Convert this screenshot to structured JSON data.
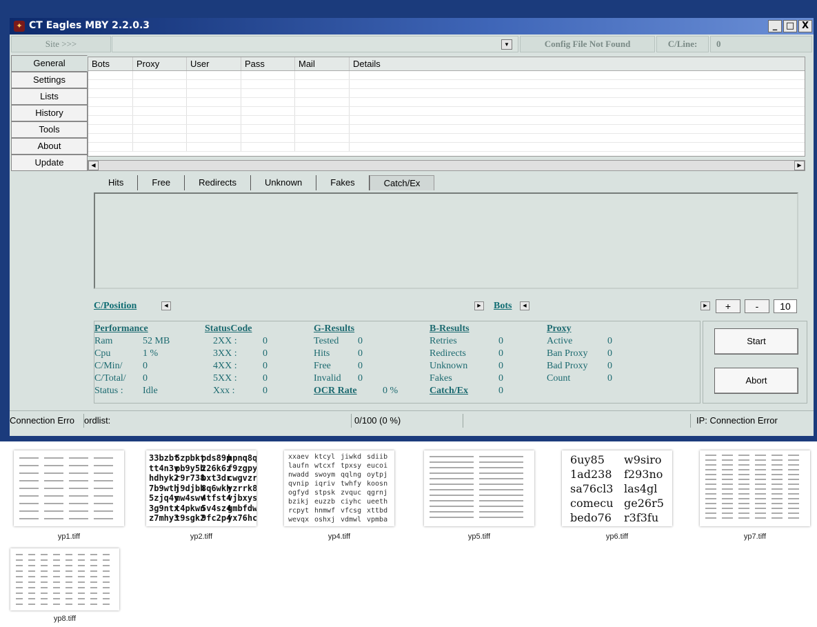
{
  "window": {
    "title": "CT Eagles MBY 2.2.0.3",
    "buttons": [
      "_",
      "□",
      "X"
    ]
  },
  "sitebar": {
    "site_label": "Site >>>",
    "config_status": "Config File Not Found",
    "cline_label": "C/Line:",
    "cline_value": "0"
  },
  "nav": [
    "General",
    "Settings",
    "Lists",
    "History",
    "Tools",
    "About",
    "Update"
  ],
  "grid": {
    "columns": [
      "Bots",
      "Proxy",
      "User",
      "Pass",
      "Mail",
      "Details"
    ]
  },
  "tabs": [
    "Hits",
    "Free",
    "Redirects",
    "Unknown",
    "Fakes",
    "Catch/Ex"
  ],
  "position_row": {
    "cposition": "C/Position",
    "bots": "Bots",
    "plus": "+",
    "minus": "-",
    "count": "10"
  },
  "stats": {
    "performance": {
      "header": "Performance",
      "rows": [
        [
          "Ram",
          "52 MB"
        ],
        [
          "Cpu",
          "1 %"
        ],
        [
          "C/Min/",
          "0"
        ],
        [
          "C/Total/",
          "0"
        ],
        [
          "Status :",
          "Idle"
        ]
      ]
    },
    "statuscode": {
      "header": "StatusCode",
      "rows": [
        [
          "2XX :",
          "0"
        ],
        [
          "3XX :",
          "0"
        ],
        [
          "4XX :",
          "0"
        ],
        [
          "5XX :",
          "0"
        ],
        [
          "Xxx :",
          "0"
        ]
      ]
    },
    "gresults": {
      "header": "G-Results",
      "rows": [
        [
          "Tested",
          "0"
        ],
        [
          "Hits",
          "0"
        ],
        [
          "Free",
          "0"
        ],
        [
          "Invalid",
          "0"
        ]
      ],
      "ocr_label": "OCR Rate",
      "ocr_value": "0 %"
    },
    "bresults": {
      "header": "B-Results",
      "rows": [
        [
          "Retries",
          "0"
        ],
        [
          "Redirects",
          "0"
        ],
        [
          "Unknown",
          "0"
        ],
        [
          "Fakes",
          "0"
        ]
      ],
      "catch_label": "Catch/Ex",
      "catch_value": "0"
    },
    "proxy": {
      "header": "Proxy",
      "rows": [
        [
          "Active",
          "0"
        ],
        [
          "Ban Proxy",
          "0"
        ],
        [
          "Bad Proxy",
          "0"
        ],
        [
          "Count",
          "0"
        ]
      ]
    }
  },
  "actions": {
    "start": "Start",
    "abort": "Abort"
  },
  "statusbar": {
    "connection": "Connection Erro",
    "wordlist": "ordlist:",
    "progress": "0/100 (0 %)",
    "ip": "IP:  Connection Error"
  },
  "thumbnails": [
    {
      "label": "yp1.tiff"
    },
    {
      "label": "yp2.tiff",
      "rows": [
        [
          "33bzbt",
          "5zpbkt",
          "pds89p",
          "hpnq8q"
        ],
        [
          "tt4n3v",
          "pb9y5b",
          "226k6z",
          "f9zgpy"
        ],
        [
          "hdhyk2",
          "r9r738",
          "bxt3dr",
          "cwgvzr"
        ],
        [
          "7b9wth",
          "j9djbh",
          "8q6wkh",
          "yzrrk8"
        ],
        [
          "5zjq4y",
          "mw4swv",
          "4tfst4",
          "vjbxys"
        ],
        [
          "3g9ntx",
          "t4pkwn",
          "5v4sz4",
          "gmbfdw"
        ],
        [
          "z7mhy3",
          "t9sgk2",
          "9fc2p4",
          "yx76hc"
        ]
      ]
    },
    {
      "label": "yp4.tiff",
      "rows": [
        [
          "xxaev",
          "ktcyl",
          "jiwkd",
          "sdiib"
        ],
        [
          "laufn",
          "wtcxf",
          "tpxsy",
          "eucoi"
        ],
        [
          "nwadd",
          "swoym",
          "qqlng",
          "oytpj"
        ],
        [
          "qvnip",
          "iqriv",
          "twhfy",
          "koosn"
        ],
        [
          "ogfyd",
          "stpsk",
          "zvquc",
          "qgrnj"
        ],
        [
          "bzikj",
          "euzzb",
          "ciyhc",
          "ueeth"
        ],
        [
          "rcpyt",
          "hnmwf",
          "vfcsg",
          "xttbd"
        ],
        [
          "wevqx",
          "oshxj",
          "vdmwl",
          "vpmba"
        ]
      ]
    },
    {
      "label": "yp5.tiff"
    },
    {
      "label": "yp6.tiff",
      "rows": [
        [
          "6uy85",
          "w9siro"
        ],
        [
          "1ad238",
          "f293no"
        ],
        [
          "sa76cl3",
          "las4gl"
        ],
        [
          "comecu",
          "ge26r5"
        ],
        [
          "bedo76",
          "r3f3fu"
        ]
      ]
    },
    {
      "label": "yp7.tiff"
    },
    {
      "label": "yp8.tiff"
    }
  ]
}
